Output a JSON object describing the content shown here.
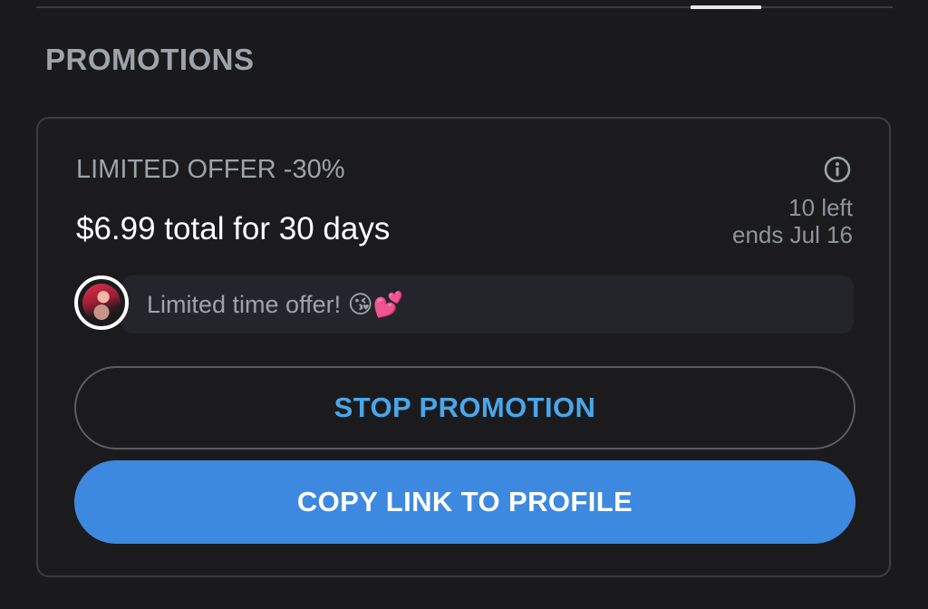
{
  "header": {
    "section_title": "PROMOTIONS"
  },
  "promotion": {
    "offer_label": "LIMITED OFFER -30%",
    "price_text": "$6.99 total for 30 days",
    "remaining": "10 left",
    "ends": "ends Jul 16",
    "message": "Limited time offer! 😘💕",
    "info_icon": "info-circle-icon"
  },
  "actions": {
    "stop_label": "STOP PROMOTION",
    "copy_label": "COPY LINK TO PROFILE"
  },
  "colors": {
    "background": "#1a1a1c",
    "accent_blue": "#3d89e0",
    "link_blue": "#4aa6ea",
    "muted_text": "#9ea3ab"
  }
}
